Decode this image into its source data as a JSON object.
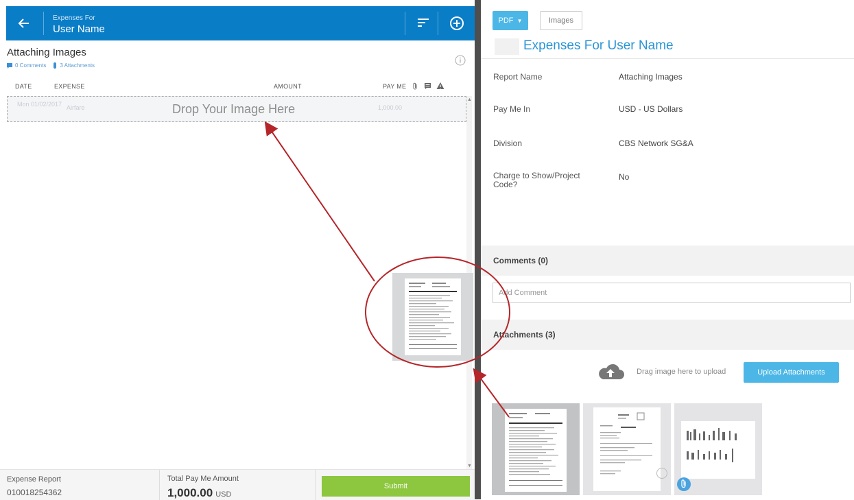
{
  "header": {
    "subtitle": "Expenses For",
    "title": "User Name"
  },
  "report": {
    "title": "Attaching Images",
    "comments_count": "0 Comments",
    "attachments_count": "3 Attachments"
  },
  "table": {
    "columns": [
      "DATE",
      "EXPENSE",
      "AMOUNT",
      "PAY ME"
    ],
    "ghost_row": {
      "date": "Mon 01/02/2017",
      "expense": "Airfare",
      "amount": "1,000.00"
    },
    "drop_text": "Drop Your Image Here"
  },
  "footer": {
    "report_label": "Expense Report",
    "report_number": "010018254362",
    "total_label": "Total Pay Me Amount",
    "total_amount": "1,000.00",
    "total_currency": "USD",
    "submit_label": "Submit"
  },
  "right": {
    "pdf_label": "PDF",
    "images_label": "Images",
    "title_prefix": "Expenses For",
    "title_name": "User Name",
    "fields": [
      {
        "label": "Report Name",
        "value": "Attaching Images"
      },
      {
        "label": "Pay Me In",
        "value": "USD - US Dollars"
      },
      {
        "label": "Division",
        "value": "CBS Network SG&A"
      },
      {
        "label": "Charge to Show/Project Code?",
        "value": "No"
      }
    ],
    "comments_header": "Comments (0)",
    "comment_placeholder": "Add Comment",
    "attachments_header": "Attachments (3)",
    "drag_text": "Drag image here to upload",
    "upload_label": "Upload Attachments"
  },
  "colors": {
    "header_blue": "#0a7dc7",
    "accent_blue": "#4cb7e6",
    "submit_green": "#8dc63f",
    "annotation_red": "#b5262a"
  },
  "icons": [
    "back-arrow-icon",
    "sort-icon",
    "add-circle-icon",
    "info-icon",
    "comment-icon",
    "paperclip-icon",
    "warning-icon",
    "cloud-upload-icon",
    "caret-down-icon",
    "clock-icon"
  ]
}
